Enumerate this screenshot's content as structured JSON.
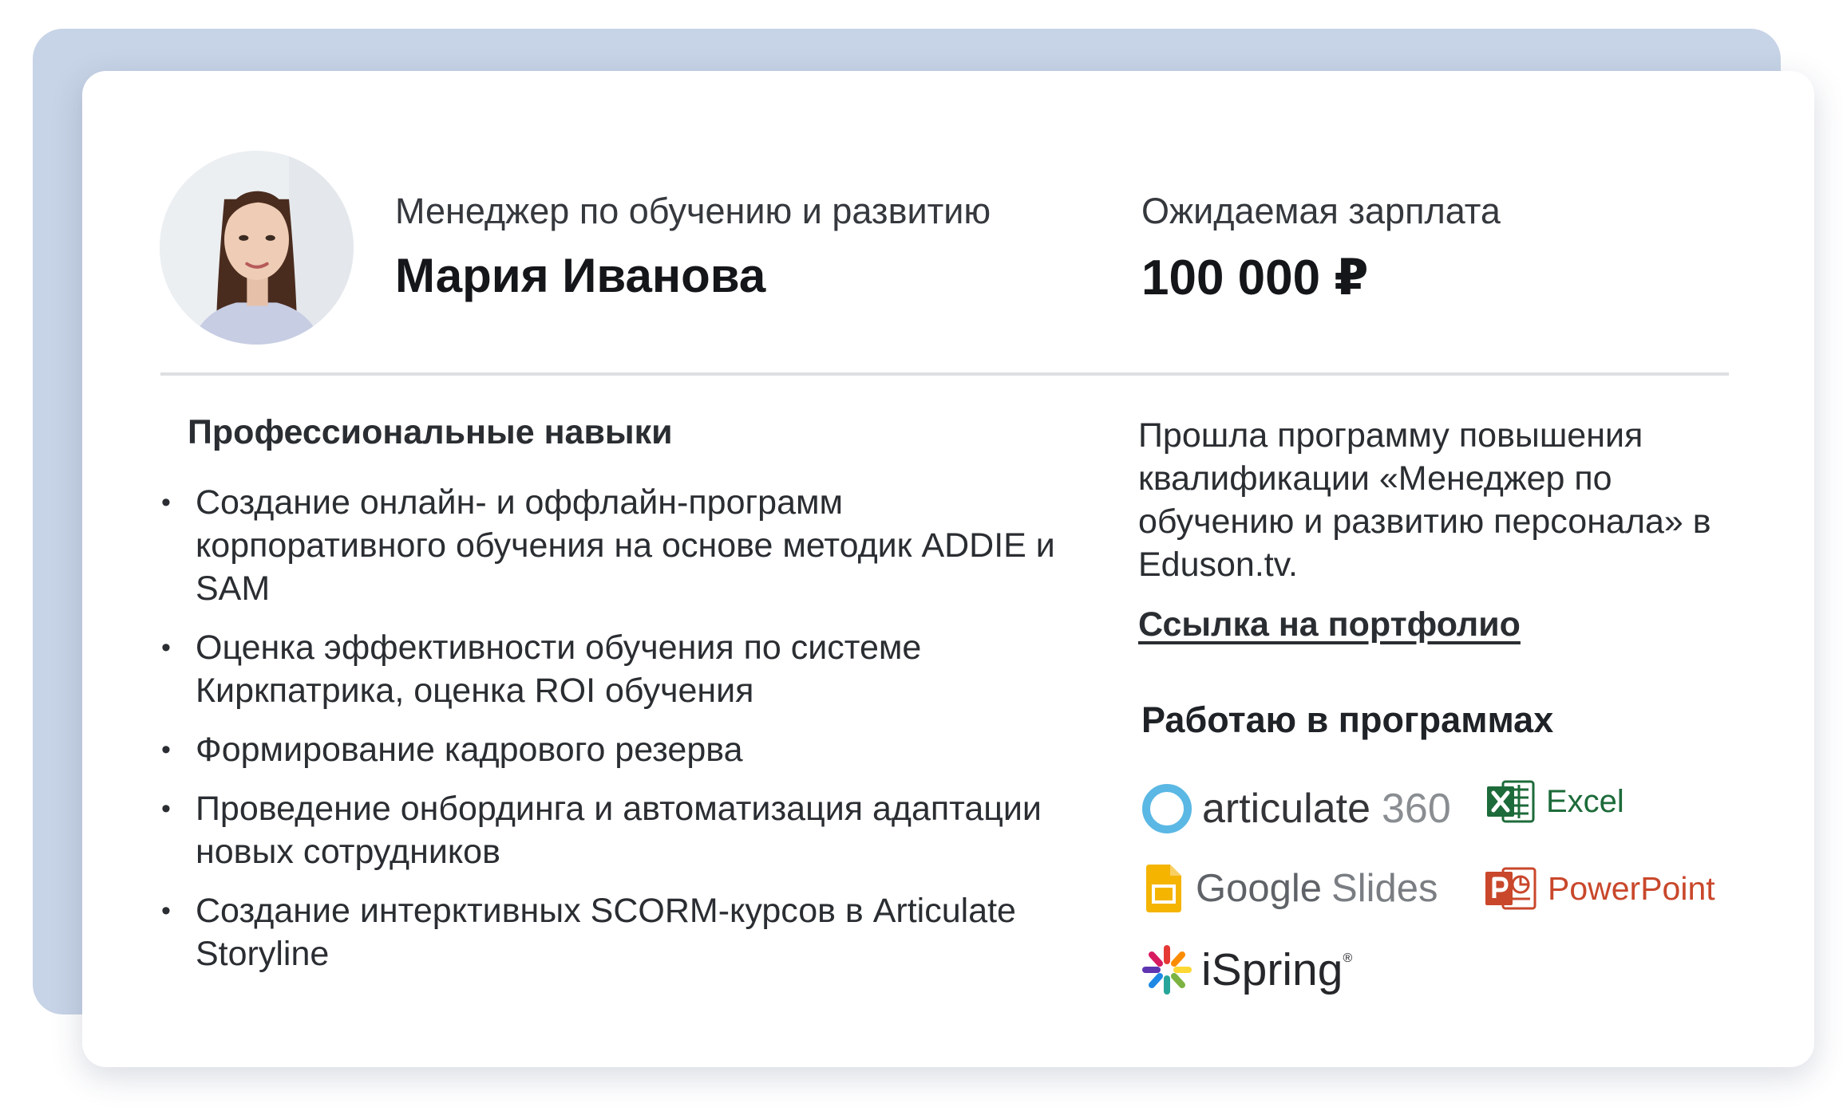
{
  "profile": {
    "role": "Менеджер по обучению и развитию",
    "name": "Мария Иванова",
    "salary_label": "Ожидаемая зарплата",
    "salary_value": "100 000 ₽"
  },
  "skills": {
    "title": "Профессиональные навыки",
    "bullet": "•",
    "items": [
      "Создание онлайн- и оффлайн-программ корпоративного обучения на основе методик ADDIE и SAM",
      "Оценка эффективности обучения по системе Киркпатрика, оценка ROI обучения",
      "Формирование кадрового резерва",
      "Проведение онбординга и автоматизация адаптации новых сотрудников",
      "Создание интерктивных SCORM-курсов в Articulate Storyline"
    ]
  },
  "education": {
    "text": "Прошла программу повышения квалификации «Менеджер по обучению и развитию персонала» в Eduson.tv.",
    "portfolio_link": "Ссылка на портфолио"
  },
  "software": {
    "title": "Работаю в программах",
    "articulate": {
      "word": "articulate",
      "suffix": "360",
      "icon": "articulate-ring-icon",
      "color": "#5bb8e4"
    },
    "excel": {
      "label": "Excel",
      "icon": "excel-icon",
      "color": "#1d6b3a"
    },
    "google_slides": {
      "word": "Google",
      "suffix": "Slides",
      "icon": "google-slides-icon",
      "color": "#f4b400"
    },
    "powerpoint": {
      "label": "PowerPoint",
      "icon": "powerpoint-icon",
      "color": "#c9472b"
    },
    "ispring": {
      "label": "iSpring",
      "mark": "®",
      "icon": "ispring-icon"
    }
  },
  "colors": {
    "back_card": "#c7d3e6",
    "divider": "#dedfe2",
    "text": "#2a2d31"
  }
}
